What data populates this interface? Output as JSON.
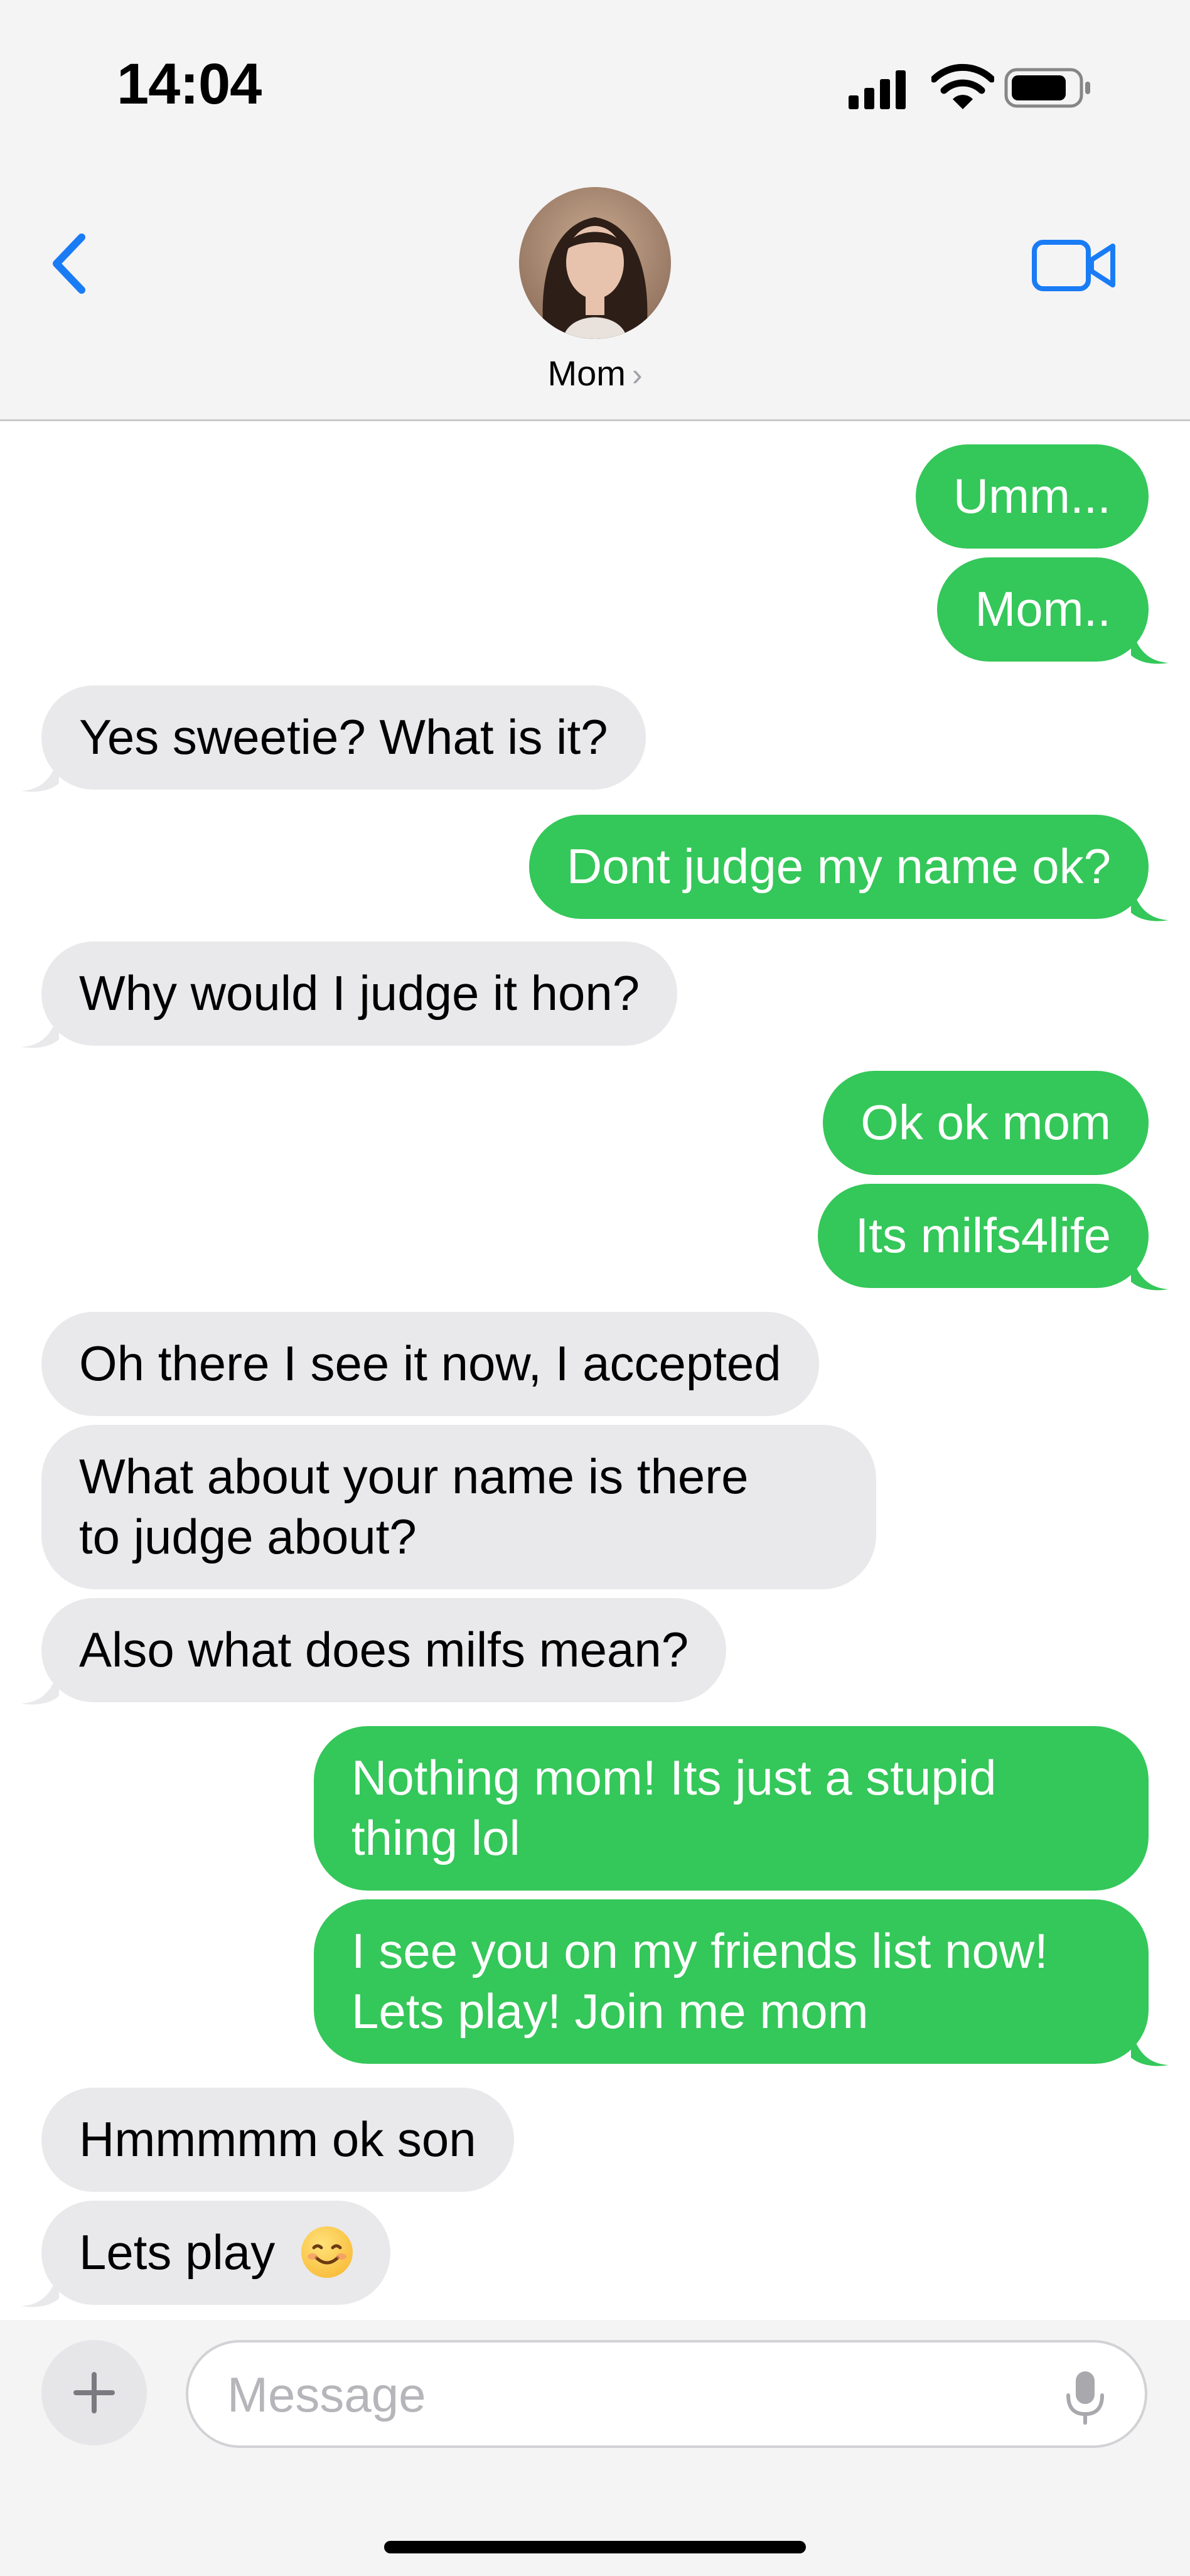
{
  "status_bar": {
    "time": "14:04"
  },
  "contact": {
    "name": "Mom",
    "chevron": "›"
  },
  "icons": {
    "back": "chevron-left-icon",
    "video": "video-camera-icon",
    "plus": "plus-icon",
    "mic": "microphone-icon",
    "emoji": "smiling-face-emoji"
  },
  "colors": {
    "sent": "#34c759",
    "received": "#e9e9eb",
    "accent": "#1a7cf5"
  },
  "messages": [
    {
      "from": "me",
      "text": "Umm..."
    },
    {
      "from": "me",
      "text": "Mom.."
    },
    {
      "from": "mom",
      "text": "Yes sweetie? What is it?"
    },
    {
      "from": "me",
      "text": "Dont judge my name ok?"
    },
    {
      "from": "mom",
      "text": "Why would I judge it hon?"
    },
    {
      "from": "me",
      "text": "Ok ok mom"
    },
    {
      "from": "me",
      "text": "Its milfs4life"
    },
    {
      "from": "mom",
      "text": "Oh there I see it now, I accepted"
    },
    {
      "from": "mom",
      "lines": [
        "What about your name is there",
        "to judge about?"
      ]
    },
    {
      "from": "mom",
      "text": "Also what does milfs mean?"
    },
    {
      "from": "me",
      "lines": [
        "Nothing mom! Its just a stupid",
        "thing lol"
      ]
    },
    {
      "from": "me",
      "lines": [
        "I see you on my friends list now!",
        "Lets play! Join me mom"
      ]
    },
    {
      "from": "mom",
      "text": "Hmmmmm ok son"
    },
    {
      "from": "mom",
      "text": "Lets play"
    }
  ],
  "composer": {
    "placeholder": "Message"
  }
}
